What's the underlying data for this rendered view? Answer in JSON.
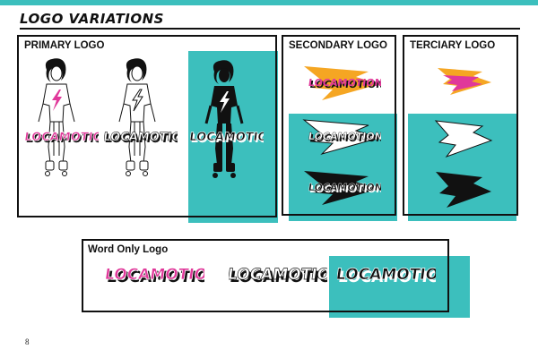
{
  "page": {
    "heading": "LOGO VARIATIONS",
    "page_number": "8"
  },
  "colors": {
    "accent_teal": "#3cbfbd",
    "logo_pink": "#e0389a",
    "logo_orange": "#f5a623",
    "ink": "#111111"
  },
  "sections": {
    "primary": {
      "title": "PRIMARY LOGO",
      "wordmark": "LOCAMOTION"
    },
    "secondary": {
      "title": "SECONDARY LOGO",
      "wordmark": "LOCAMOTION"
    },
    "terciary": {
      "title": "TERCIARY LOGO"
    },
    "word_only": {
      "title": "Word Only Logo",
      "wordmark": "LOCAMOTION"
    }
  }
}
